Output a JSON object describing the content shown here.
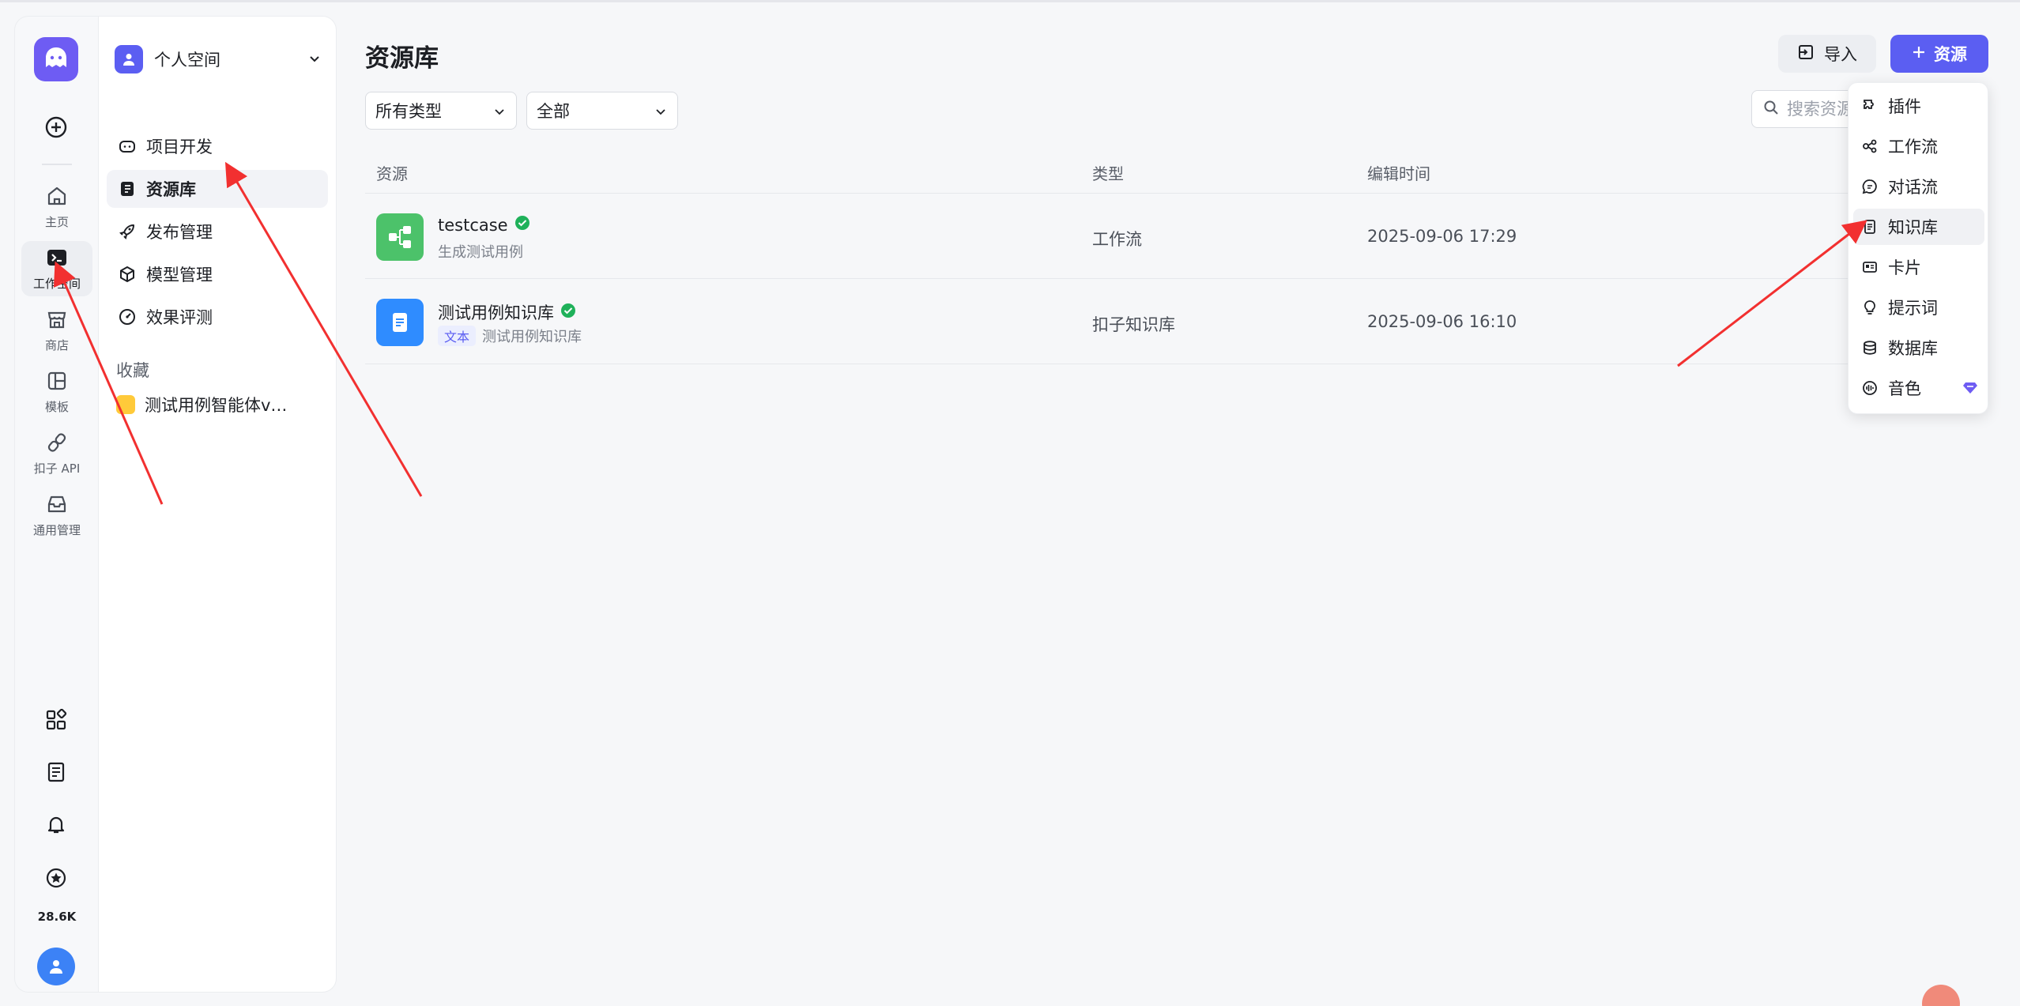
{
  "rail": {
    "items": [
      {
        "label": "主页",
        "icon": "home-icon"
      },
      {
        "label": "工作空间",
        "icon": "workspace-terminal-icon"
      },
      {
        "label": "商店",
        "icon": "store-icon"
      },
      {
        "label": "模板",
        "icon": "template-icon"
      },
      {
        "label": "扣子 API",
        "icon": "api-icon"
      },
      {
        "label": "通用管理",
        "icon": "inbox-icon"
      }
    ],
    "stars_count": "28.6K"
  },
  "nav": {
    "space_name": "个人空间",
    "items": [
      {
        "label": "项目开发"
      },
      {
        "label": "资源库"
      },
      {
        "label": "发布管理"
      },
      {
        "label": "模型管理"
      },
      {
        "label": "效果评测"
      }
    ],
    "favorites_title": "收藏",
    "favorites": [
      {
        "label": "测试用例智能体v…"
      }
    ]
  },
  "main": {
    "title": "资源库",
    "import_label": "导入",
    "add_label": "资源",
    "filters": {
      "type": "所有类型",
      "scope": "全部"
    },
    "search_placeholder": "搜索资源",
    "columns": [
      "资源",
      "类型",
      "编辑时间"
    ],
    "rows": [
      {
        "name": "testcase",
        "desc": "生成测试用例",
        "tag": "",
        "type": "工作流",
        "time": "2025-09-06 17:29",
        "color": "#4cc26a"
      },
      {
        "name": "测试用例知识库",
        "desc": "测试用例知识库",
        "tag": "文本",
        "type": "扣子知识库",
        "time": "2025-09-06 16:10",
        "color": "#2f8cff"
      }
    ]
  },
  "menu": {
    "items": [
      {
        "label": "插件"
      },
      {
        "label": "工作流"
      },
      {
        "label": "对话流"
      },
      {
        "label": "知识库"
      },
      {
        "label": "卡片"
      },
      {
        "label": "提示词"
      },
      {
        "label": "数据库"
      },
      {
        "label": "音色"
      }
    ]
  },
  "colors": {
    "accent": "#5b5ef2",
    "annotation_arrow": "#f23030"
  }
}
